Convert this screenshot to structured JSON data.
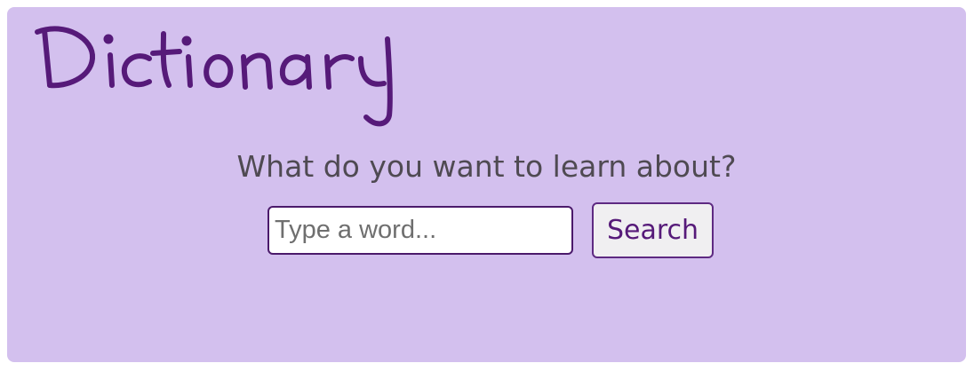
{
  "app": {
    "title": "Dictionary"
  },
  "main": {
    "prompt": "What do you want to learn about?"
  },
  "search": {
    "placeholder": "Type a word...",
    "value": "",
    "button_label": "Search"
  },
  "colors": {
    "card_background": "#d3c0ee",
    "brand_purple": "#561a79",
    "prompt_text": "#4f4a52",
    "button_background": "#f0eff1"
  }
}
